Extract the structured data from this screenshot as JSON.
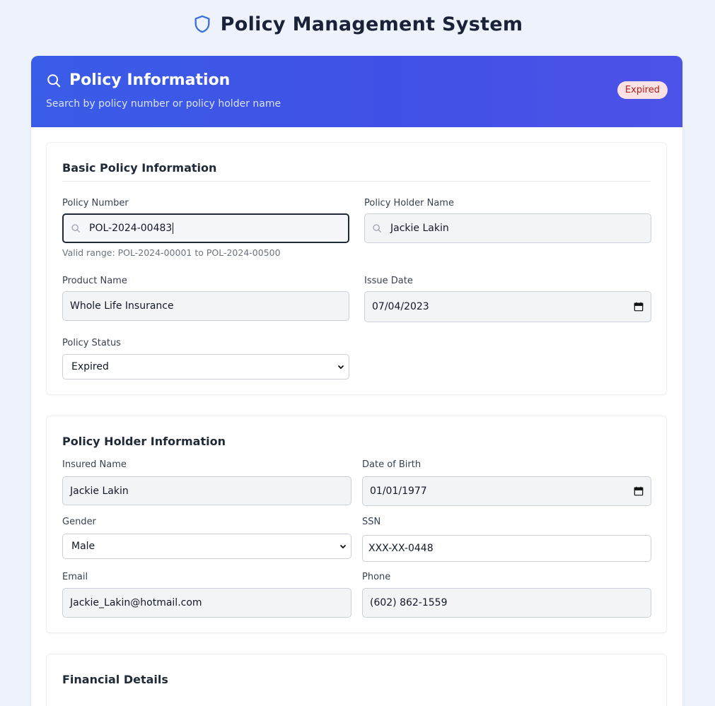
{
  "app": {
    "title": "Policy Management System"
  },
  "hero": {
    "title": "Policy Information",
    "subtitle": "Search by policy number or policy holder name",
    "status": "Expired"
  },
  "basic": {
    "title": "Basic Policy Information",
    "policy_number_label": "Policy Number",
    "policy_number": "POL-2024-00483",
    "policy_number_hint": "Valid range: POL-2024-00001 to POL-2024-00500",
    "holder_name_label": "Policy Holder Name",
    "holder_name": "Jackie Lakin",
    "product_label": "Product Name",
    "product": "Whole Life Insurance",
    "issue_date_label": "Issue Date",
    "issue_date": "07/04/2023",
    "status_label": "Policy Status",
    "status": "Expired"
  },
  "holder": {
    "title": "Policy Holder Information",
    "insured_label": "Insured Name",
    "insured": "Jackie Lakin",
    "dob_label": "Date of Birth",
    "dob": "01/01/1977",
    "gender_label": "Gender",
    "gender": "Male",
    "ssn_label": "SSN",
    "ssn": "XXX-XX-0448",
    "email_label": "Email",
    "email": "Jackie_Lakin@hotmail.com",
    "phone_label": "Phone",
    "phone": "(602) 862-1559"
  },
  "financial": {
    "title": "Financial Details"
  },
  "colors": {
    "accent": "#3a5de7",
    "badge_bg": "#fde2e4",
    "badge_text": "#b91c1c",
    "shield": "#3b6fe0"
  },
  "icons": {
    "header": "shield-icon",
    "hero": "search-icon",
    "field": "search-icon",
    "date": "calendar-icon",
    "select": "chevron-down-icon"
  }
}
